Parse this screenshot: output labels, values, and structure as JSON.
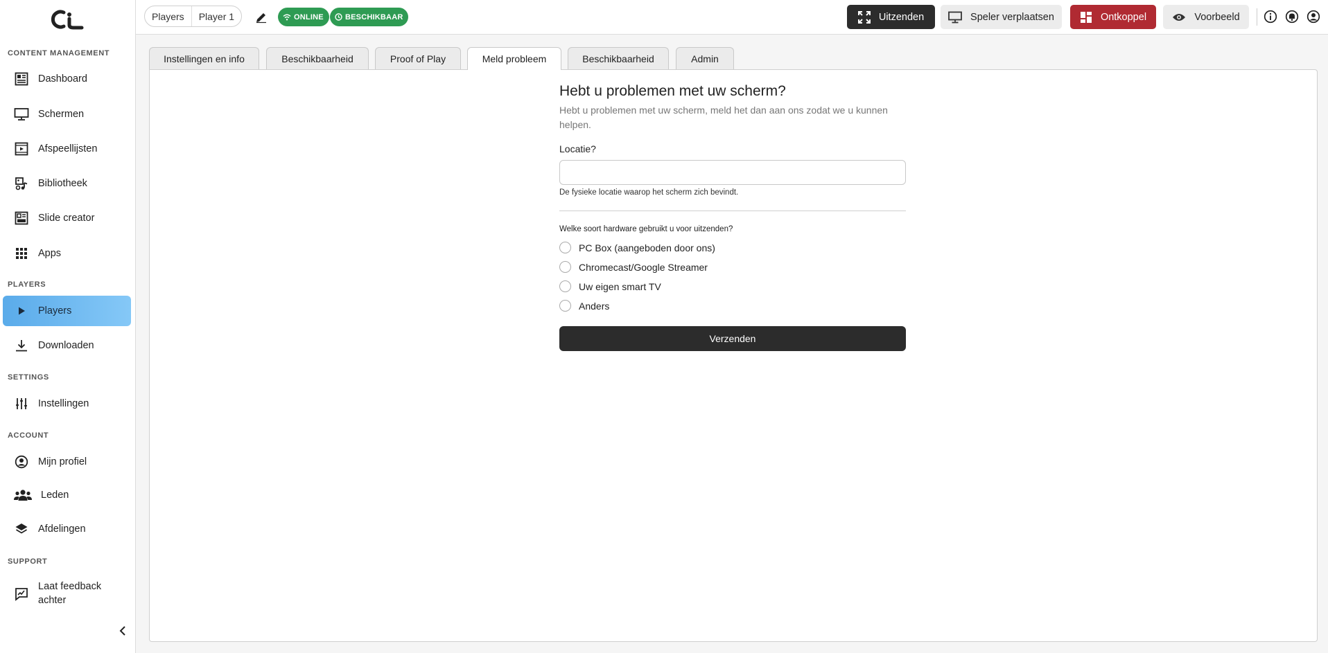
{
  "sidebar": {
    "sections": {
      "content": "CONTENT MANAGEMENT",
      "players": "PLAYERS",
      "settings": "SETTINGS",
      "account": "ACCOUNT",
      "support": "SUPPORT"
    },
    "items": {
      "dashboard": "Dashboard",
      "schermen": "Schermen",
      "afspeellijsten": "Afspeellijsten",
      "bibliotheek": "Bibliotheek",
      "slide_creator": "Slide creator",
      "apps": "Apps",
      "players": "Players",
      "downloaden": "Downloaden",
      "instellingen": "Instellingen",
      "mijn_profiel": "Mijn profiel",
      "leden": "Leden",
      "afdelingen": "Afdelingen",
      "feedback_line1": "Laat feedback",
      "feedback_line2": "achter"
    }
  },
  "header": {
    "breadcrumb": [
      "Players",
      "Player 1"
    ],
    "status_online": "ONLINE",
    "status_available": "BESCHIKBAAR",
    "buttons": {
      "uitzenden": "Uitzenden",
      "verplaatsen": "Speler verplaatsen",
      "ontkoppel": "Ontkoppel",
      "voorbeeld": "Voorbeeld"
    }
  },
  "tabs": [
    "Instellingen en info",
    "Beschikbaarheid",
    "Proof of Play",
    "Meld probleem",
    "Beschikbaarheid",
    "Admin"
  ],
  "form": {
    "title": "Hebt u problemen met uw scherm?",
    "subtitle": "Hebt u problemen met uw scherm, meld het dan aan ons zodat we u kunnen helpen.",
    "location_label": "Locatie?",
    "location_value": "",
    "location_help": "De fysieke locatie waarop het scherm zich bevindt.",
    "hardware_question": "Welke soort hardware gebruikt u voor uitzenden?",
    "options": [
      "PC Box (aangeboden door ons)",
      "Chromecast/Google Streamer",
      "Uw eigen smart TV",
      "Anders"
    ],
    "submit": "Verzenden"
  },
  "colors": {
    "active_nav": "#6bb7ef",
    "status_green": "#2e9b53",
    "danger": "#b02a32",
    "dark": "#2c2c2c"
  }
}
